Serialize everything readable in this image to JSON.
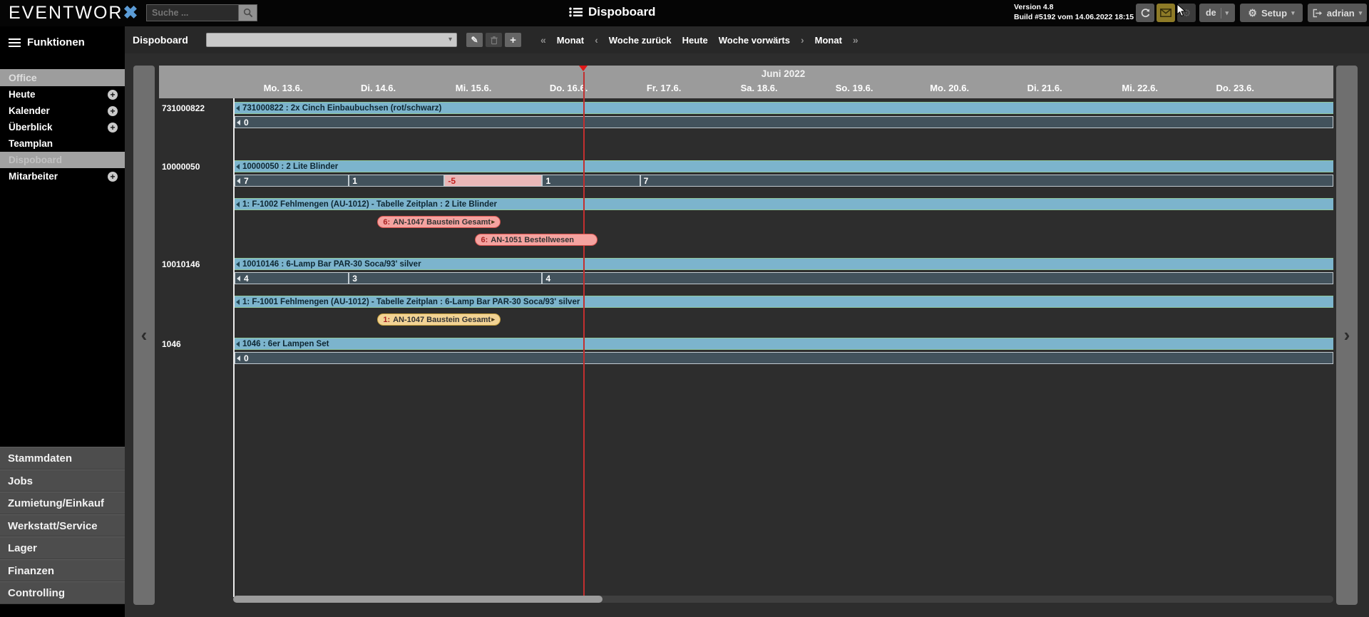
{
  "topbar": {
    "logo_text": "EVENTWOR",
    "logo_mark": "✖",
    "search": {
      "placeholder": "Suche ...",
      "value": ""
    },
    "title": "Dispoboard",
    "version_line1": "Version 4.8",
    "version_line2": "Build #5192 vom 14.06.2022 18:15",
    "language": "de",
    "setup_label": "Setup",
    "username": "adrian"
  },
  "sidebar": {
    "menu_header": "Funktionen",
    "section_label": "Office",
    "items": [
      {
        "label": "Heute",
        "expandable": true,
        "selected": false
      },
      {
        "label": "Kalender",
        "expandable": true,
        "selected": false
      },
      {
        "label": "Überblick",
        "expandable": true,
        "selected": false
      },
      {
        "label": "Teamplan",
        "expandable": false,
        "selected": false
      },
      {
        "label": "Dispoboard",
        "expandable": false,
        "selected": true
      },
      {
        "label": "Mitarbeiter",
        "expandable": true,
        "selected": false
      }
    ],
    "bottom_items": [
      "Stammdaten",
      "Jobs",
      "Zumietung/Einkauf",
      "Werkstatt/Service",
      "Lager",
      "Finanzen",
      "Controlling"
    ]
  },
  "toolbar": {
    "label": "Dispoboard",
    "select_value": "",
    "nav_items": [
      {
        "kind": "chevron",
        "label": "«"
      },
      {
        "kind": "link",
        "label": "Monat"
      },
      {
        "kind": "chevron",
        "label": "‹"
      },
      {
        "kind": "link",
        "label": "Woche zurück"
      },
      {
        "kind": "link",
        "label": "Heute"
      },
      {
        "kind": "link",
        "label": "Woche vorwärts"
      },
      {
        "kind": "chevron",
        "label": "›"
      },
      {
        "kind": "link",
        "label": "Monat"
      },
      {
        "kind": "chevron",
        "label": "»"
      }
    ]
  },
  "board": {
    "month_label": "Juni 2022",
    "days": [
      "Mo. 13.6.",
      "Di. 14.6.",
      "Mi. 15.6.",
      "Do. 16.6.",
      "Fr. 17.6.",
      "Sa. 18.6.",
      "So. 19.6.",
      "Mo. 20.6.",
      "Di. 21.6.",
      "Mi. 22.6.",
      "Do. 23.6."
    ],
    "today_line_frac": 0.319,
    "groups": [
      {
        "id": "731000822",
        "title": "731000822 : 2x Cinch Einbaubuchsen (rot/schwarz)",
        "cells": [
          {
            "value": "0",
            "from": 0,
            "to": 1,
            "negative": false
          }
        ],
        "sub_bars": [],
        "badges": []
      },
      {
        "id": "10000050",
        "title": "10000050 : 2 Lite Blinder",
        "cells": [
          {
            "value": "7",
            "from": 0,
            "to": 0.104,
            "negative": false
          },
          {
            "value": "1",
            "from": 0.104,
            "to": 0.191,
            "negative": false
          },
          {
            "value": "-5",
            "from": 0.191,
            "to": 0.28,
            "negative": true
          },
          {
            "value": "1",
            "from": 0.28,
            "to": 0.369,
            "negative": false
          },
          {
            "value": "7",
            "from": 0.369,
            "to": 1,
            "negative": false
          }
        ],
        "sub_bars": [
          {
            "label": "1: F-1002 Fehlmengen (AU-1012) - Tabelle Zeitplan : 2 Lite Blinder"
          }
        ],
        "badges": [
          {
            "label": "6: AN-1047 Baustein Gesamt",
            "color": "red",
            "from": 0.13,
            "to": 0.242,
            "arrow_right": true
          },
          {
            "label": "6: AN-1051 Bestellwesen",
            "color": "red",
            "from": 0.219,
            "to": 0.33,
            "arrow_right": false
          }
        ]
      },
      {
        "id": "10010146",
        "title": "10010146 : 6-Lamp Bar PAR-30 Soca/93' silver",
        "cells": [
          {
            "value": "4",
            "from": 0,
            "to": 0.104,
            "negative": false
          },
          {
            "value": "3",
            "from": 0.104,
            "to": 0.28,
            "negative": false
          },
          {
            "value": "4",
            "from": 0.28,
            "to": 1,
            "negative": false
          }
        ],
        "sub_bars": [
          {
            "label": "1: F-1001 Fehlmengen (AU-1012) - Tabelle Zeitplan : 6-Lamp Bar PAR-30 Soca/93' silver"
          }
        ],
        "badges": [
          {
            "label": "1: AN-1047 Baustein Gesamt",
            "color": "yellow",
            "from": 0.13,
            "to": 0.242,
            "arrow_right": true
          }
        ]
      },
      {
        "id": "1046",
        "title": "1046 : 6er Lampen Set",
        "cells": [
          {
            "value": "0",
            "from": 0,
            "to": 1,
            "negative": false
          }
        ],
        "sub_bars": [],
        "badges": []
      }
    ]
  },
  "colors": {
    "bar_blue": "#7cb4cd",
    "bar_border_green": "#90c79b",
    "cell_slate": "#42525c",
    "cell_negative_bg": "#e9b7b7",
    "cell_negative_text": "#c42323",
    "badge_red_bg": "#f5a3a0",
    "badge_red_border": "#d9534f",
    "badge_yellow_bg": "#f2d394",
    "badge_yellow_border": "#c9a23f",
    "badge_number": "#a82222",
    "today_line": "#c22f2f",
    "accent_gold": "#8e7b27"
  },
  "icons": {
    "dropdown_chevron": "▾",
    "left_scroll": "‹",
    "right_scroll": "›",
    "edit_pencil": "✎",
    "add_plus": "+",
    "gear": "⚙",
    "expand_plus": "+",
    "badge_arrow": "▸"
  }
}
